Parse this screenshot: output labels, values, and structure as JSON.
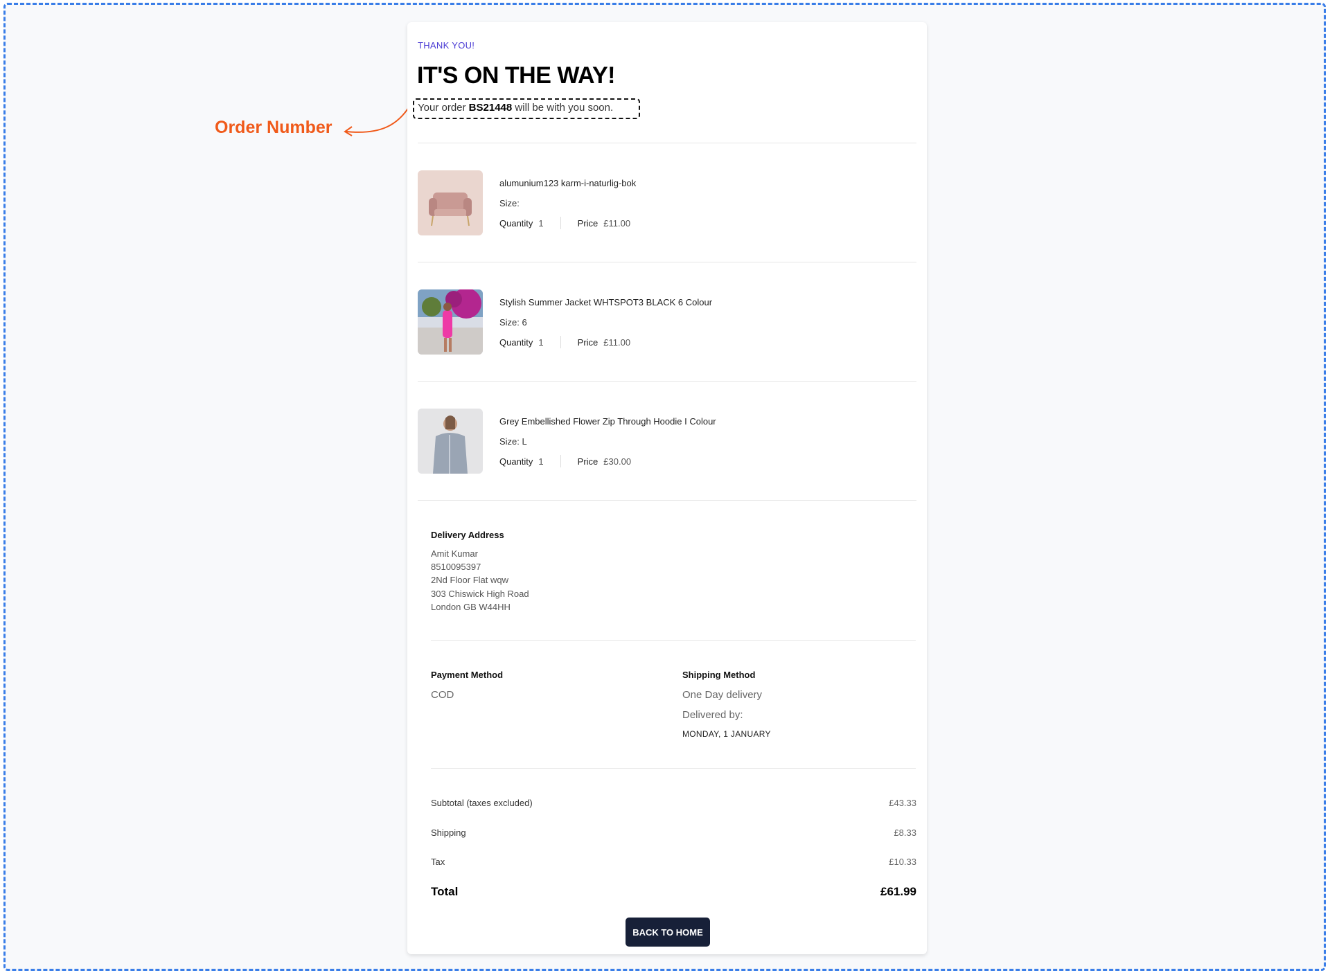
{
  "annotation": {
    "label": "Order Number",
    "color": "#f05a1a"
  },
  "header": {
    "eyebrow": "THANK YOU!",
    "title": "IT'S ON THE WAY!",
    "order_prefix": "Your order",
    "order_number": "BS21448",
    "order_suffix": "will be with you soon."
  },
  "items": [
    {
      "name": "alumunium123 karm-i-naturlig-bok",
      "size": "Size:",
      "qty_label": "Quantity",
      "qty": "1",
      "price_label": "Price",
      "price": "£11.00",
      "image": "pink-armchair"
    },
    {
      "name": "Stylish Summer Jacket WHTSPOT3 BLACK 6 Colour",
      "size": "Size: 6",
      "qty_label": "Quantity",
      "qty": "1",
      "price_label": "Price",
      "price": "£11.00",
      "image": "woman-pink-dress"
    },
    {
      "name": "Grey Embellished Flower Zip Through Hoodie I Colour",
      "size": "Size: L",
      "qty_label": "Quantity",
      "qty": "1",
      "price_label": "Price",
      "price": "£30.00",
      "image": "woman-grey-hoodie"
    }
  ],
  "delivery": {
    "title": "Delivery Address",
    "lines": [
      "Amit Kumar",
      "8510095397",
      "2Nd Floor Flat wqw",
      "303 Chiswick High Road",
      "London GB W44HH"
    ]
  },
  "payment": {
    "title": "Payment Method",
    "value": "COD"
  },
  "shipping": {
    "title": "Shipping Method",
    "method": "One Day delivery",
    "delivered_by": "Delivered by:",
    "date": "MONDAY, 1 JANUARY"
  },
  "summary": {
    "subtotal_label": "Subtotal (taxes excluded)",
    "subtotal": "£43.33",
    "shipping_label": "Shipping",
    "shipping": "£8.33",
    "tax_label": "Tax",
    "tax": "£10.33",
    "total_label": "Total",
    "total": "£61.99"
  },
  "actions": {
    "back_home": "BACK TO HOME"
  }
}
